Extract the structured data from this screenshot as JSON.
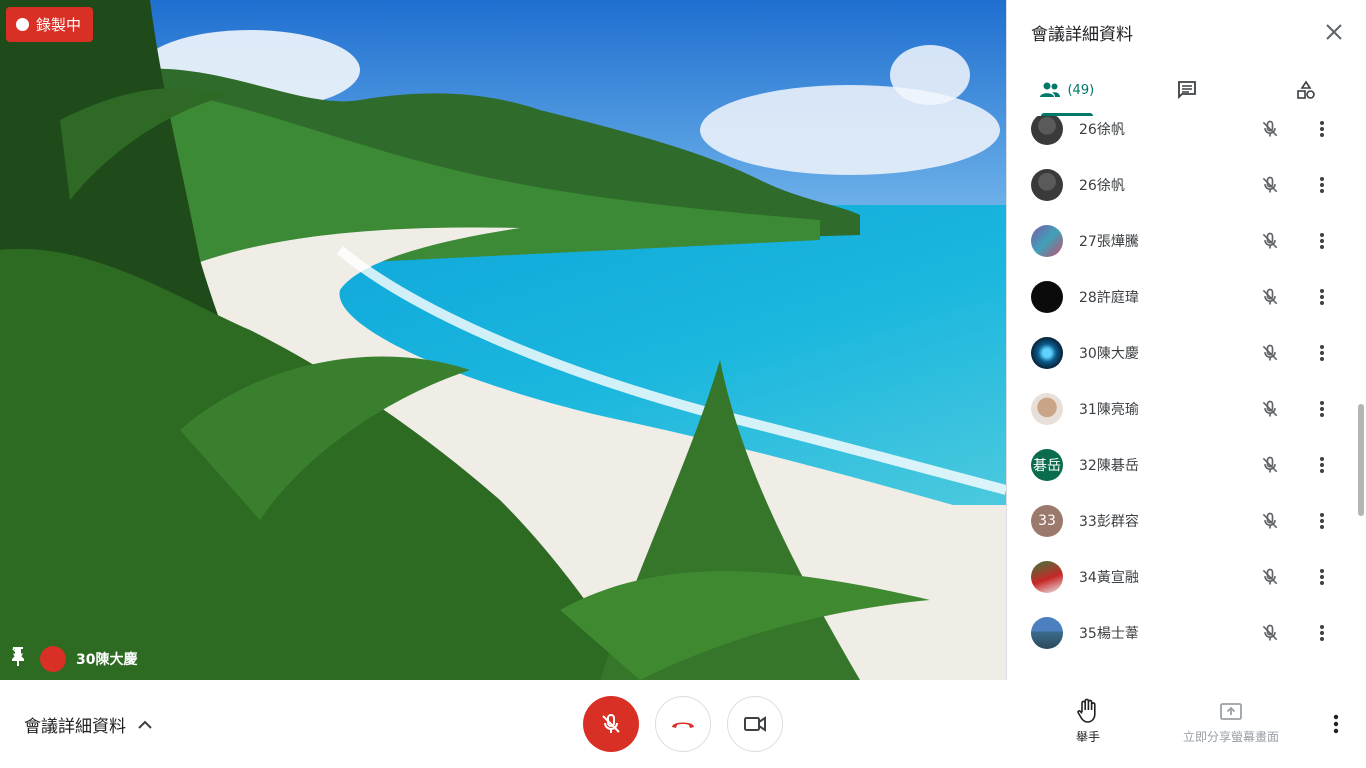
{
  "recording": {
    "label": "錄製中"
  },
  "tile": {
    "name": "30陳大慶"
  },
  "panel": {
    "title": "會議詳細資料",
    "tabs": [
      {
        "name": "people",
        "count_label": "(49)",
        "icon": "people-icon",
        "active": true
      },
      {
        "name": "chat",
        "icon": "chat-icon",
        "active": false
      },
      {
        "name": "activities",
        "icon": "activities-icon",
        "active": false
      }
    ]
  },
  "participants": [
    {
      "name": "26徐帆",
      "avatar": "dark-silhouette"
    },
    {
      "name": "26徐帆",
      "avatar": "dark-silhouette"
    },
    {
      "name": "27張燁騰",
      "avatar": "photo"
    },
    {
      "name": "28許庭瑋",
      "avatar": "black"
    },
    {
      "name": "30陳大慶",
      "avatar": "blue-glow"
    },
    {
      "name": "31陳亮瑜",
      "avatar": "photo-face"
    },
    {
      "name": "32陳碁岳",
      "avatar_text": "碁岳",
      "avatar_color": "#0b6b4f"
    },
    {
      "name": "33彭群容",
      "avatar_text": "33",
      "avatar_color": "#9b7a6d"
    },
    {
      "name": "34黃宣融",
      "avatar": "photo-red"
    },
    {
      "name": "35楊士葦",
      "avatar": "photo-landscape"
    }
  ],
  "bottom": {
    "meeting_details_label": "會議詳細資料",
    "raise_hand_label": "舉手",
    "present_label": "立即分享螢幕畫面"
  },
  "colors": {
    "accent": "#00796b",
    "danger": "#d93025"
  }
}
